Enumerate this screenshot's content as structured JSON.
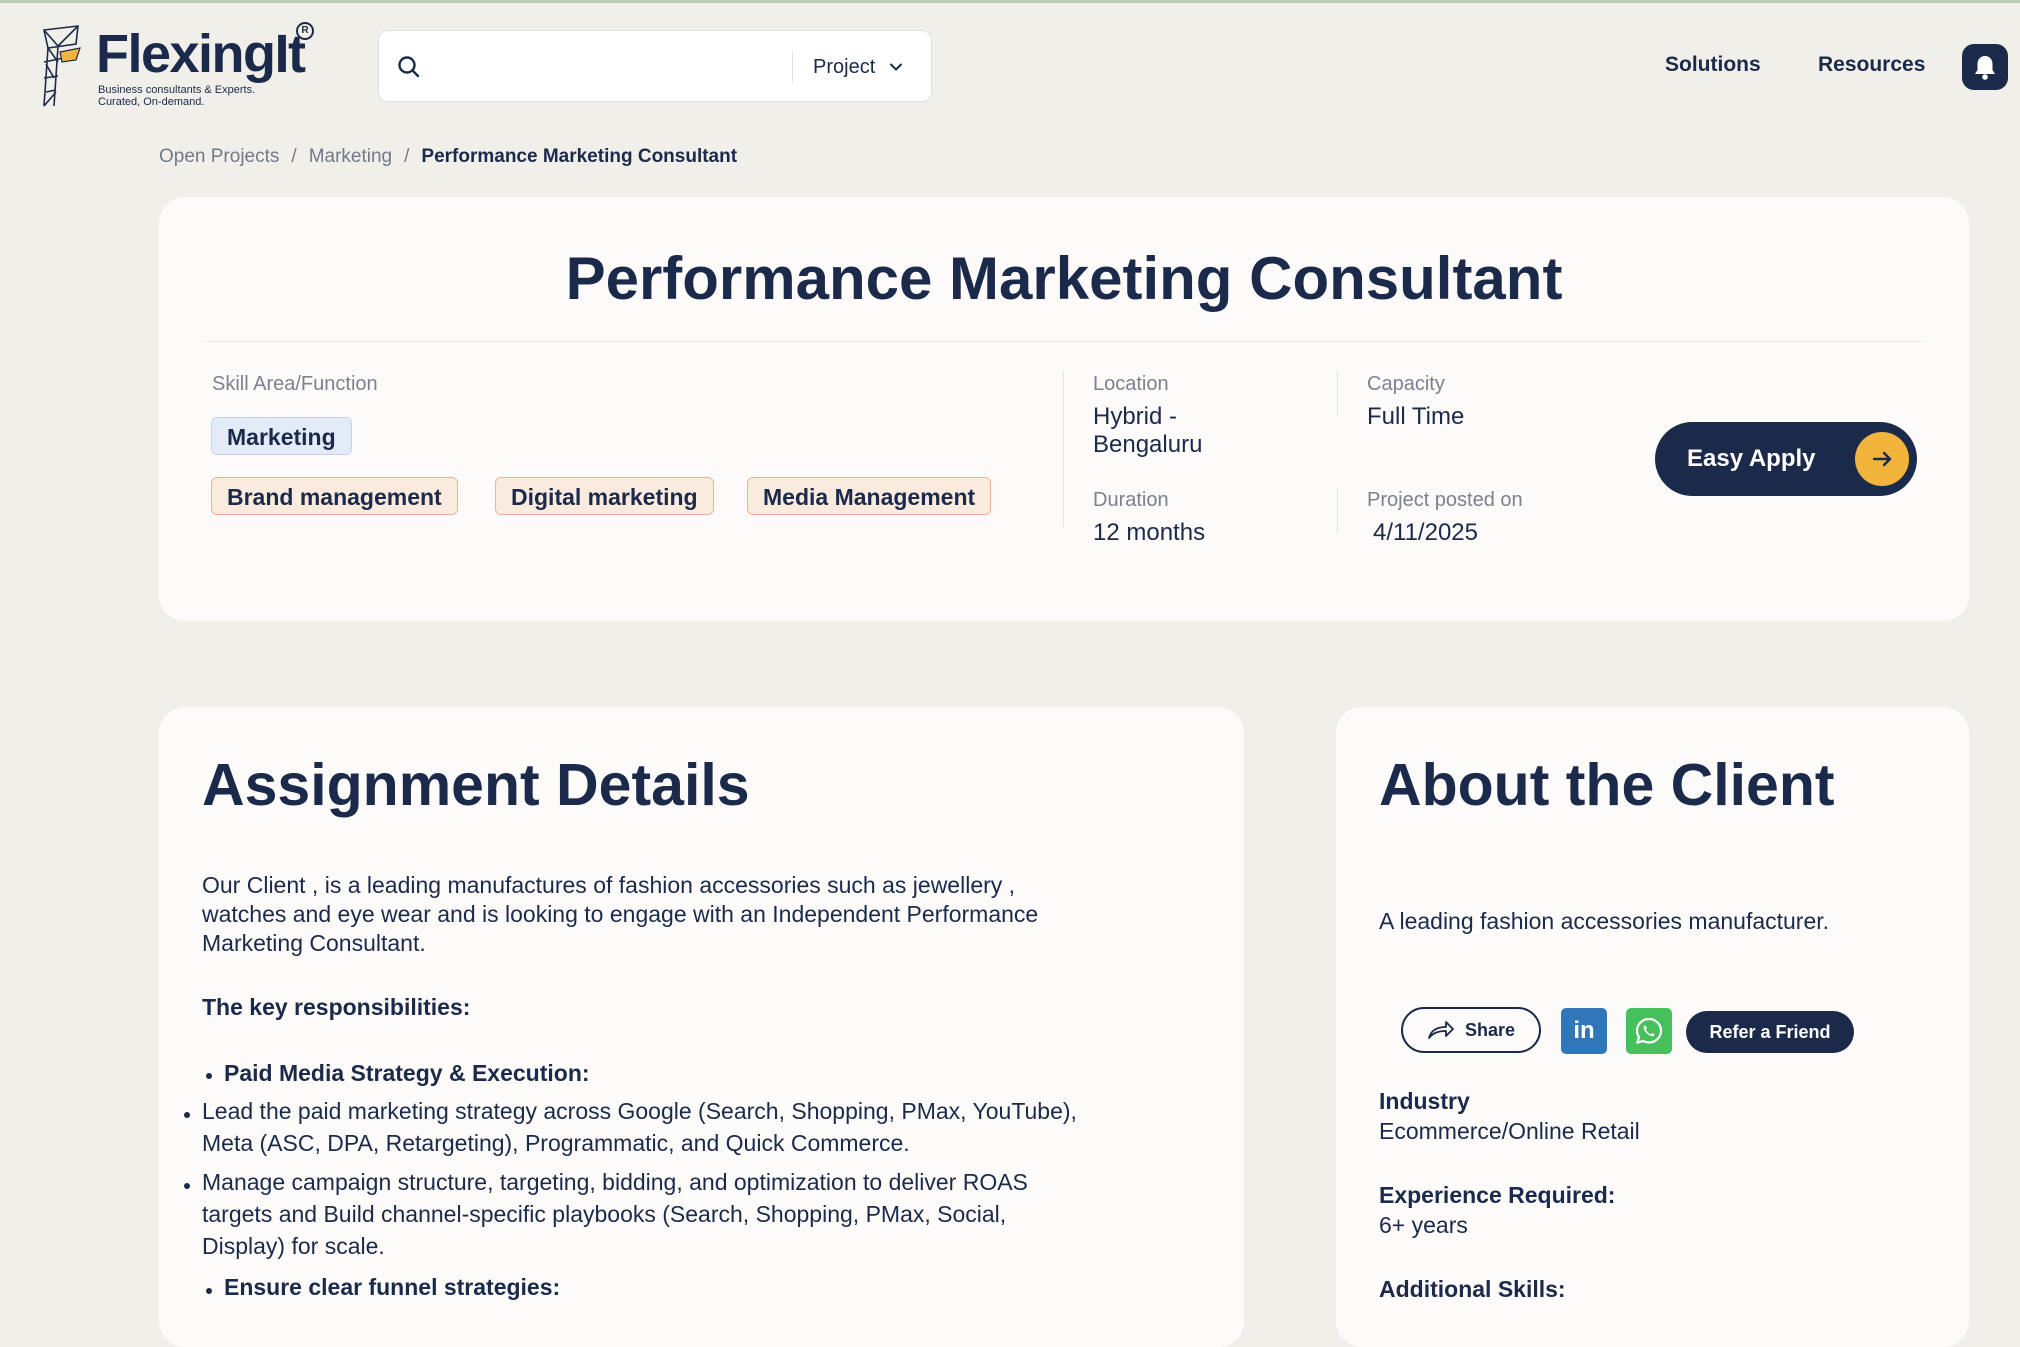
{
  "brand": {
    "name": "FlexingIt",
    "registered": "R",
    "tagline_line1": "Business consultants & Experts.",
    "tagline_line2": "Curated, On-demand."
  },
  "search": {
    "placeholder": "",
    "scope": "Project"
  },
  "nav": {
    "solutions": "Solutions",
    "resources": "Resources"
  },
  "breadcrumb": {
    "items": [
      "Open Projects",
      "Marketing"
    ],
    "current": "Performance Marketing Consultant",
    "separator": "/"
  },
  "project": {
    "title": "Performance Marketing Consultant",
    "skill_area_label": "Skill Area/Function",
    "function_tag": "Marketing",
    "skill_tags": [
      "Brand management",
      "Digital marketing",
      "Media Management"
    ],
    "location_label": "Location",
    "location_line1": "Hybrid -",
    "location_line2": "Bengaluru",
    "capacity_label": "Capacity",
    "capacity_value": "Full Time",
    "duration_label": "Duration",
    "duration_value": "12 months",
    "posted_label": "Project posted on",
    "posted_value": "4/11/2025",
    "apply_label": "Easy Apply"
  },
  "assignment": {
    "title": "Assignment Details",
    "intro_line1": "Our Client , is a leading  manufactures of  fashion accessories such as jewellery ,",
    "intro_line2": "watches and eye wear and is looking to engage with  an Independent Performance",
    "intro_line3": "Marketing Consultant.",
    "responsibilities_heading": "The key responsibilities:",
    "sub1_heading": "Paid Media Strategy & Execution:",
    "item1_line1": "Lead the paid marketing strategy across Google (Search, Shopping, PMax, YouTube),",
    "item1_line2": "Meta (ASC, DPA, Retargeting), Programmatic, and Quick Commerce.",
    "item2_line1": "Manage campaign structure, targeting, bidding, and optimization to deliver ROAS",
    "item2_line2": "targets and Build channel-specific playbooks (Search, Shopping, PMax, Social,",
    "item2_line3": "Display) for scale.",
    "sub2_heading": "Ensure clear funnel strategies:"
  },
  "client": {
    "title": "About the Client",
    "description": "A leading fashion accessories manufacturer.",
    "share_label": "Share",
    "refer_label": "Refer a Friend",
    "linkedin_glyph": "in",
    "industry_label": "Industry",
    "industry_value": "Ecommerce/Online Retail",
    "experience_label": "Experience Required:",
    "experience_value": "6+ years",
    "additional_label": "Additional Skills:"
  },
  "colors": {
    "navy": "#1b2a4a",
    "accent": "#f2b43a",
    "linkedin": "#2f77b8",
    "whatsapp": "#46c05a",
    "page_bg": "#f0efea"
  }
}
